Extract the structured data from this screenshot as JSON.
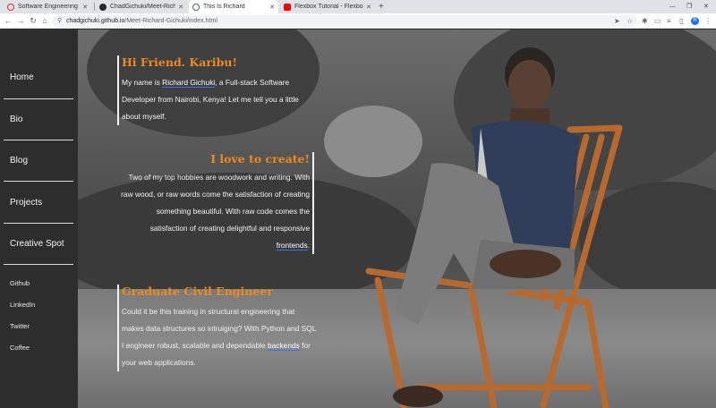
{
  "browser": {
    "tabs": [
      {
        "label": "Software Engineering SI...",
        "favicon_color": "#d93025",
        "active": false
      },
      {
        "label": "ChadGichuki/Meet-Richar...",
        "favicon_color": "#24292f",
        "active": false
      },
      {
        "label": "This Is Richard",
        "favicon_color": "#5f6368",
        "active": true
      },
      {
        "label": "Flexbox Tutorial - Flexbox...",
        "favicon_color": "#ff0000",
        "active": false
      }
    ],
    "url_host": "chadgichuki.github.io",
    "url_path": "/Meet-Richard-Gichuki/index.html",
    "profile_initial": "R"
  },
  "sidebar": {
    "items": [
      {
        "label": "Home"
      },
      {
        "label": "Bio"
      },
      {
        "label": "Blog"
      },
      {
        "label": "Projects"
      },
      {
        "label": "Creative Spot"
      }
    ],
    "links": [
      {
        "label": "Github"
      },
      {
        "label": "LinkedIn"
      },
      {
        "label": "Twitter"
      },
      {
        "label": "Coffee"
      }
    ]
  },
  "content": {
    "intro": {
      "title": "Hi Friend. Karibu!",
      "text_before": "My name is ",
      "name": "Richard Gichuki",
      "text_after": ", a Full-stack Software Developer from Nairobi, Kenya! Let me tell you a little about myself."
    },
    "create": {
      "title": "I love to create!",
      "text_before": "Two of my top hobbies are woodwork and writing. With raw wood, or raw words come the satisfaction of creating something beautiful. With raw code comes the satisfaction of creating delightful and responsive ",
      "link": "frontends",
      "text_after": "."
    },
    "engineer": {
      "title": "Graduate Civil Engineer",
      "text_before": "Could it be this training in structural engineering that makes data structures so intruiging? With Python and SQL I engineer robust, scalable and dependable ",
      "link": "backends",
      "text_after": " for your web applications."
    }
  },
  "colors": {
    "accent": "#f08a1c",
    "sidebar_bg": "#2d2d2d",
    "link_underline": "#3c6cff"
  }
}
